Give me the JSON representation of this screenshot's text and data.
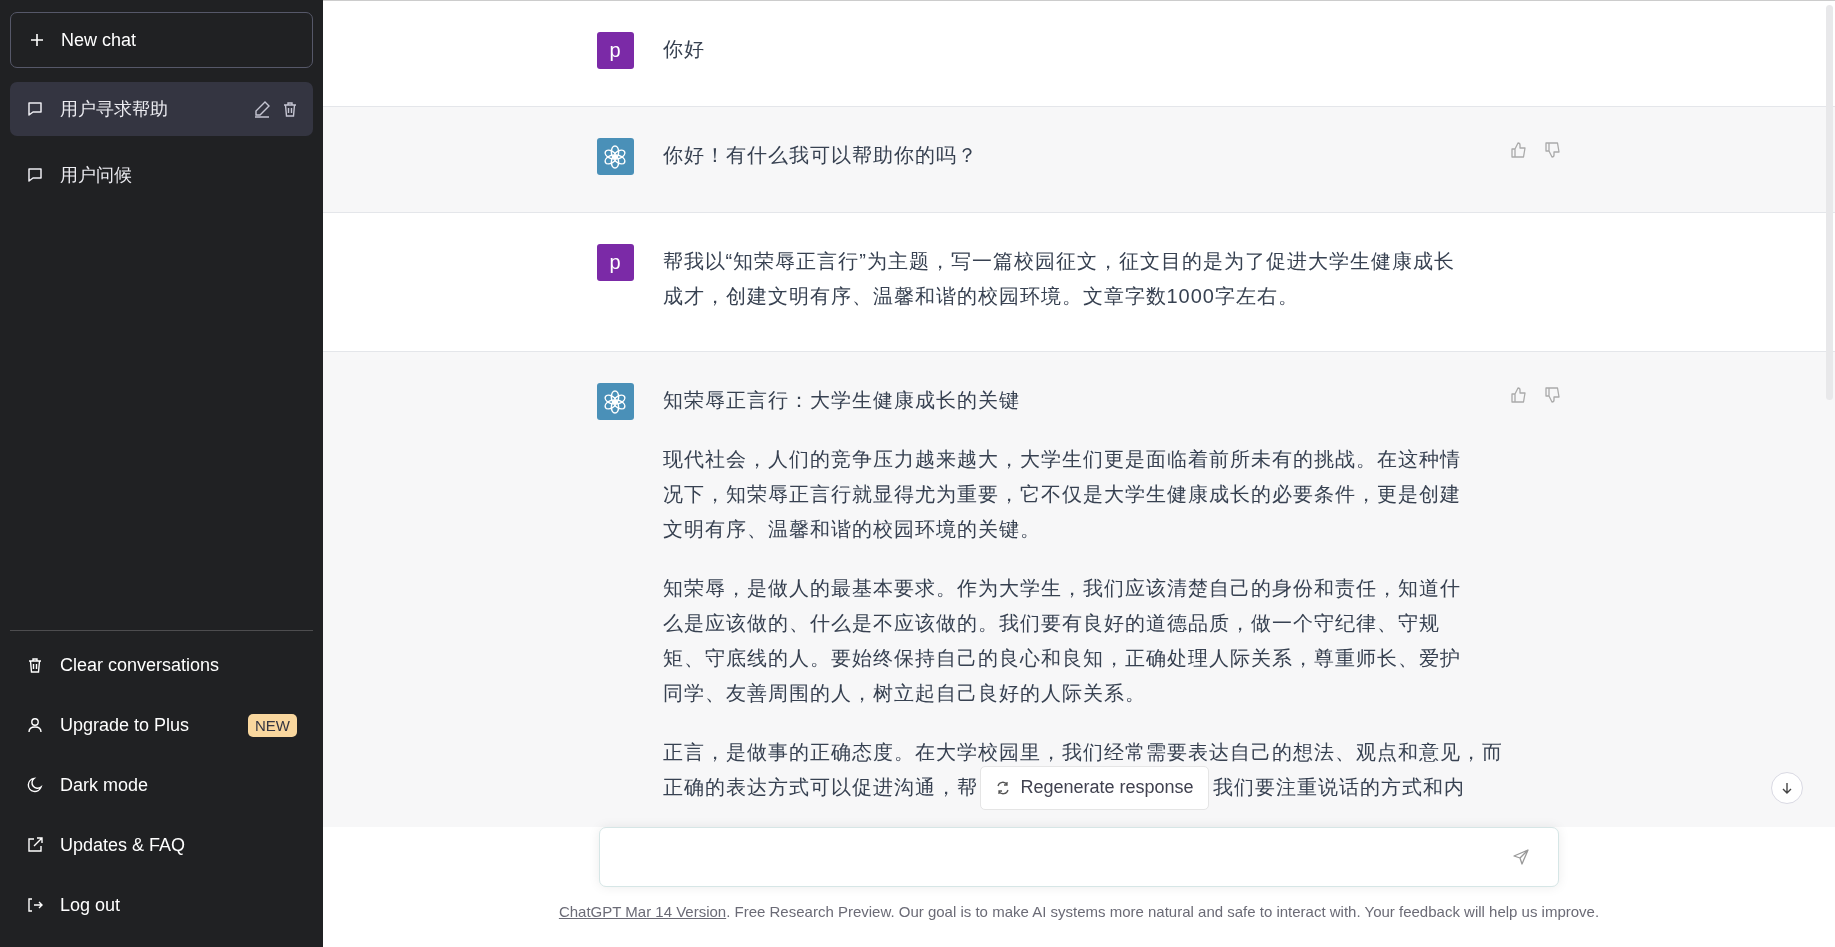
{
  "sidebar": {
    "new_chat_button": "New chat",
    "conversations": [
      {
        "title": "用户寻求帮助",
        "selected": true
      },
      {
        "title": "用户问候",
        "selected": false
      }
    ],
    "menu": [
      {
        "kind": "clear",
        "label": "Clear conversations"
      },
      {
        "kind": "upgrade",
        "label": "Upgrade to Plus",
        "badge": "NEW"
      },
      {
        "kind": "theme",
        "label": "Dark mode"
      },
      {
        "kind": "link",
        "label": "Updates & FAQ"
      },
      {
        "kind": "logout",
        "label": "Log out"
      }
    ]
  },
  "messages": [
    {
      "kind": "user",
      "avatar": "p",
      "paragraphs": [
        "你好"
      ]
    },
    {
      "kind": "assistant",
      "paragraphs": [
        "你好！有什么我可以帮助你的吗？"
      ]
    },
    {
      "kind": "user",
      "avatar": "p",
      "paragraphs": [
        "帮我以“知荣辱正言行”为主题，写一篇校园征文，征文目的是为了促进大学生健康成长成才，创建文明有序、温馨和谐的校园环境。文章字数1000字左右。"
      ]
    },
    {
      "kind": "assistant",
      "paragraphs": [
        "知荣辱正言行：大学生健康成长的关键",
        "现代社会，人们的竞争压力越来越大，大学生们更是面临着前所未有的挑战。在这种情况下，知荣辱正言行就显得尤为重要，它不仅是大学生健康成长的必要条件，更是创建文明有序、温馨和谐的校园环境的关键。",
        "知荣辱，是做人的最基本要求。作为大学生，我们应该清楚自己的身份和责任，知道什么是应该做的、什么是不应该做的。我们要有良好的道德品质，做一个守纪律、守规矩、守底线的人。要始终保持自己的良心和良知，正确处理人际关系，尊重师长、爱护同学、友善周围的人，树立起自己良好的人际关系。"
      ],
      "partial_lines": [
        {
          "text": "正言，是做事的正确态度。在大学校园里，我们经常需要表达自己的想法、观点和意见，而"
        },
        {
          "before": "正确的表达方式可以促进沟通，帮",
          "after": "我们要注重说话的方式和内"
        }
      ]
    }
  ],
  "regenerate_button": "Regenerate response",
  "footer": {
    "link": "ChatGPT Mar 14 Version",
    "text": ". Free Research Preview. Our goal is to make AI systems more natural and safe to interact with. Your feedback will help us improve."
  }
}
